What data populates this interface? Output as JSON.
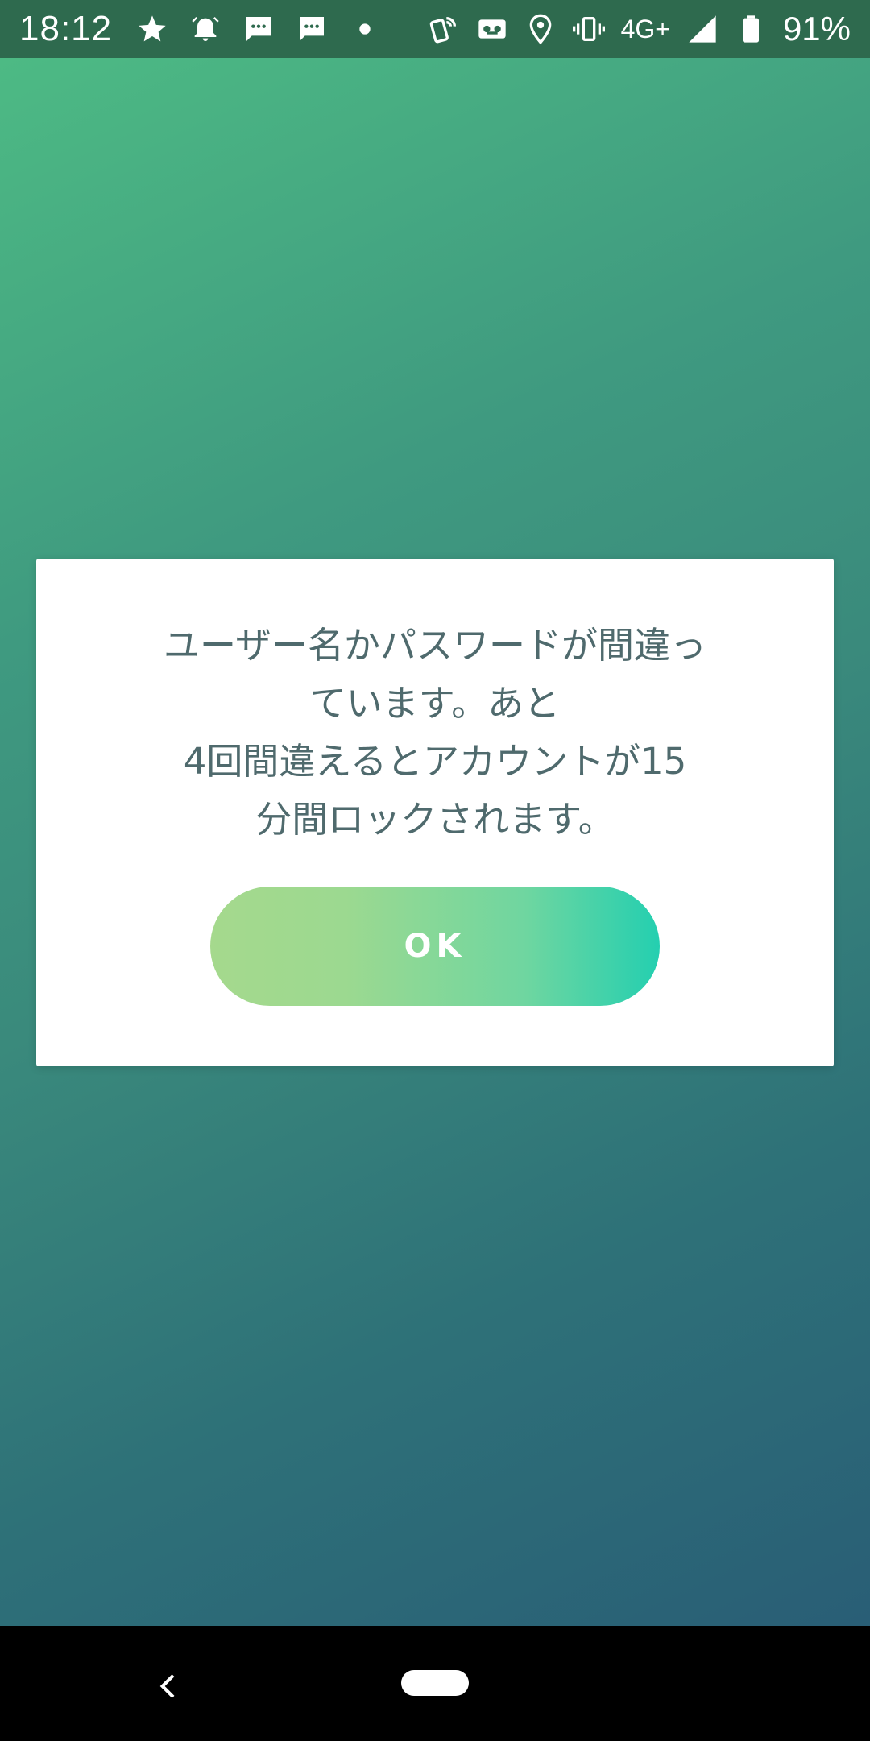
{
  "status_bar": {
    "time": "18:12",
    "network": "4G+",
    "battery": "91%",
    "icons_left": [
      "star-icon",
      "alarm-icon",
      "message-icon",
      "message-icon",
      "dot-icon"
    ],
    "icons_right": [
      "nfc-icon",
      "voicemail-icon",
      "location-icon",
      "vibrate-icon",
      "signal-icon",
      "battery-icon"
    ]
  },
  "dialog": {
    "message": "ユーザー名かパスワードが間違っ\nています。あと\n4回間違えるとアカウントが15\n分間ロックされます。",
    "ok_label": "OK"
  },
  "colors": {
    "background_start": "#4dba84",
    "background_end": "#295e76",
    "message_text": "#4f6a6d",
    "button_start": "#a5d98d",
    "button_end": "#24cfb0"
  }
}
